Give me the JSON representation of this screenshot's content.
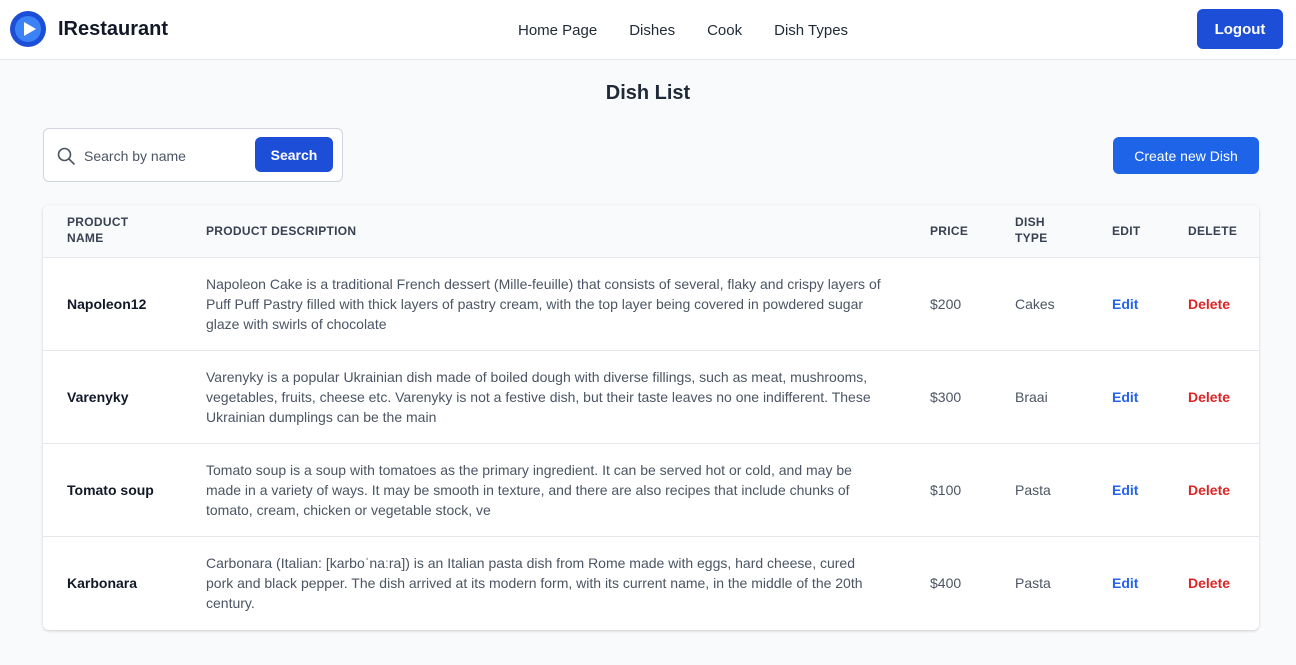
{
  "app": {
    "name": "IRestaurant"
  },
  "nav": {
    "links": [
      {
        "label": "Home Page"
      },
      {
        "label": "Dishes"
      },
      {
        "label": "Cook"
      },
      {
        "label": "Dish Types"
      }
    ],
    "logout_label": "Logout"
  },
  "page": {
    "title": "Dish List"
  },
  "search": {
    "placeholder": "Search by name",
    "value": "",
    "button_label": "Search"
  },
  "actions": {
    "create_label": "Create new Dish"
  },
  "table": {
    "headers": {
      "name": "Product Name",
      "description": "Product Description",
      "price": "Price",
      "type": "Dish Type",
      "edit": "Edit",
      "delete": "Delete"
    },
    "rows": [
      {
        "name": "Napoleon12",
        "description": "Napoleon Cake is a traditional French dessert (Mille-feuille) that consists of several, flaky and crispy layers of Puff Puff Pastry filled with thick layers of pastry cream, with the top layer being covered in powdered sugar glaze with swirls of chocolate",
        "price": "$200",
        "type": "Cakes",
        "edit": "Edit",
        "delete": "Delete"
      },
      {
        "name": "Varenyky",
        "description": "Varenyky is a popular Ukrainian dish made of boiled dough with diverse fillings, such as meat, mushrooms, vegetables, fruits, cheese etc. Varenyky is not a festive dish, but their taste leaves no one indifferent. These Ukrainian dumplings can be the main",
        "price": "$300",
        "type": "Braai",
        "edit": "Edit",
        "delete": "Delete"
      },
      {
        "name": "Tomato soup",
        "description": "Tomato soup is a soup with tomatoes as the primary ingredient. It can be served hot or cold, and may be made in a variety of ways. It may be smooth in texture, and there are also recipes that include chunks of tomato, cream, chicken or vegetable stock, ve",
        "price": "$100",
        "type": "Pasta",
        "edit": "Edit",
        "delete": "Delete"
      },
      {
        "name": "Karbonara",
        "description": "Carbonara (Italian: [karboˈnaːra]) is an Italian pasta dish from Rome made with eggs, hard cheese, cured pork and black pepper. The dish arrived at its modern form, with its current name, in the middle of the 20th century.",
        "price": "$400",
        "type": "Pasta",
        "edit": "Edit",
        "delete": "Delete"
      }
    ]
  },
  "colors": {
    "primary": "#1d4ed8",
    "link": "#2563eb",
    "danger": "#dc2626"
  },
  "icons": {
    "logo": "play-circle-icon",
    "search": "search-icon"
  }
}
